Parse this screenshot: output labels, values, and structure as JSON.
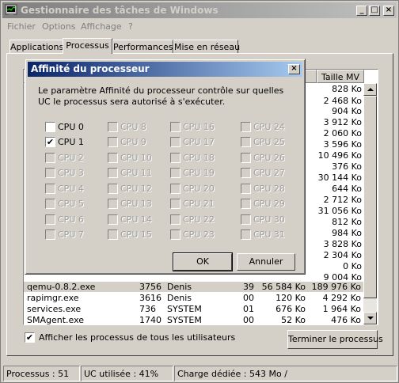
{
  "window": {
    "title": "Gestionnaire des tâches de Windows",
    "minimize_glyph": "_",
    "maximize_glyph": "□",
    "close_glyph": "×"
  },
  "menu": [
    "Fichier",
    "Options",
    "Affichage",
    "?"
  ],
  "tabs": [
    "Applications",
    "Processus",
    "Performances",
    "Mise en réseau"
  ],
  "active_tab": "Processus",
  "process_list": {
    "visible_column_header": "Taille MV",
    "vm_column_behind_dialog": [
      "828 Ko",
      "2 468 Ko",
      "904 Ko",
      "3 912 Ko",
      "2 060 Ko",
      "3 596 Ko",
      "10 496 Ko",
      "376 Ko",
      "30 144 Ko",
      "644 Ko",
      "2 712 Ko",
      "31 056 Ko",
      "812 Ko",
      "984 Ko",
      "3 828 Ko",
      "2 304 Ko",
      "0 Ko",
      "9 004 Ko"
    ],
    "rows": [
      {
        "name": "qemu-0.8.2.exe",
        "pid": "3756",
        "user": "Denis",
        "cpu": "39",
        "mem": "56 584 Ko",
        "vm": "189 976 Ko",
        "selected": true
      },
      {
        "name": "rapimgr.exe",
        "pid": "3616",
        "user": "Denis",
        "cpu": "00",
        "mem": "120 Ko",
        "vm": "4 292 Ko",
        "selected": false
      },
      {
        "name": "services.exe",
        "pid": "736",
        "user": "SYSTEM",
        "cpu": "01",
        "mem": "676 Ko",
        "vm": "1 964 Ko",
        "selected": false
      },
      {
        "name": "SMAgent.exe",
        "pid": "1740",
        "user": "SYSTEM",
        "cpu": "00",
        "mem": "52 Ko",
        "vm": "476 Ko",
        "selected": false
      }
    ]
  },
  "show_all_users": {
    "label": "Afficher les processus de tous les utilisateurs",
    "checked": true
  },
  "end_process_button": "Terminer le processus",
  "status": {
    "processes": "Processus : 51",
    "cpu_usage": "UC utilisée : 41%",
    "commit_charge": "Charge dédiée : 543 Mo /"
  },
  "dialog": {
    "title": "Affinité du processeur",
    "close_glyph": "×",
    "description": "Le paramètre Affinité du processeur contrôle sur quelles UC le processus sera autorisé à s'exécuter.",
    "cpus": [
      {
        "label": "CPU 0",
        "checked": false,
        "enabled": true
      },
      {
        "label": "CPU 1",
        "checked": true,
        "enabled": true
      },
      {
        "label": "CPU 2",
        "checked": false,
        "enabled": false
      },
      {
        "label": "CPU 3",
        "checked": false,
        "enabled": false
      },
      {
        "label": "CPU 4",
        "checked": false,
        "enabled": false
      },
      {
        "label": "CPU 5",
        "checked": false,
        "enabled": false
      },
      {
        "label": "CPU 6",
        "checked": false,
        "enabled": false
      },
      {
        "label": "CPU 7",
        "checked": false,
        "enabled": false
      },
      {
        "label": "CPU 8",
        "checked": false,
        "enabled": false
      },
      {
        "label": "CPU 9",
        "checked": false,
        "enabled": false
      },
      {
        "label": "CPU 10",
        "checked": false,
        "enabled": false
      },
      {
        "label": "CPU 11",
        "checked": false,
        "enabled": false
      },
      {
        "label": "CPU 12",
        "checked": false,
        "enabled": false
      },
      {
        "label": "CPU 13",
        "checked": false,
        "enabled": false
      },
      {
        "label": "CPU 14",
        "checked": false,
        "enabled": false
      },
      {
        "label": "CPU 15",
        "checked": false,
        "enabled": false
      },
      {
        "label": "CPU 16",
        "checked": false,
        "enabled": false
      },
      {
        "label": "CPU 17",
        "checked": false,
        "enabled": false
      },
      {
        "label": "CPU 18",
        "checked": false,
        "enabled": false
      },
      {
        "label": "CPU 19",
        "checked": false,
        "enabled": false
      },
      {
        "label": "CPU 20",
        "checked": false,
        "enabled": false
      },
      {
        "label": "CPU 21",
        "checked": false,
        "enabled": false
      },
      {
        "label": "CPU 22",
        "checked": false,
        "enabled": false
      },
      {
        "label": "CPU 23",
        "checked": false,
        "enabled": false
      },
      {
        "label": "CPU 24",
        "checked": false,
        "enabled": false
      },
      {
        "label": "CPU 25",
        "checked": false,
        "enabled": false
      },
      {
        "label": "CPU 26",
        "checked": false,
        "enabled": false
      },
      {
        "label": "CPU 27",
        "checked": false,
        "enabled": false
      },
      {
        "label": "CPU 28",
        "checked": false,
        "enabled": false
      },
      {
        "label": "CPU 29",
        "checked": false,
        "enabled": false
      },
      {
        "label": "CPU 30",
        "checked": false,
        "enabled": false
      },
      {
        "label": "CPU 31",
        "checked": false,
        "enabled": false
      }
    ],
    "ok": "OK",
    "cancel": "Annuler"
  },
  "colors": {
    "face": "#d4d0c8",
    "inactive_title_start": "#7f7f7f",
    "active_title_start": "#0a246a",
    "active_title_end": "#a6caf0"
  }
}
